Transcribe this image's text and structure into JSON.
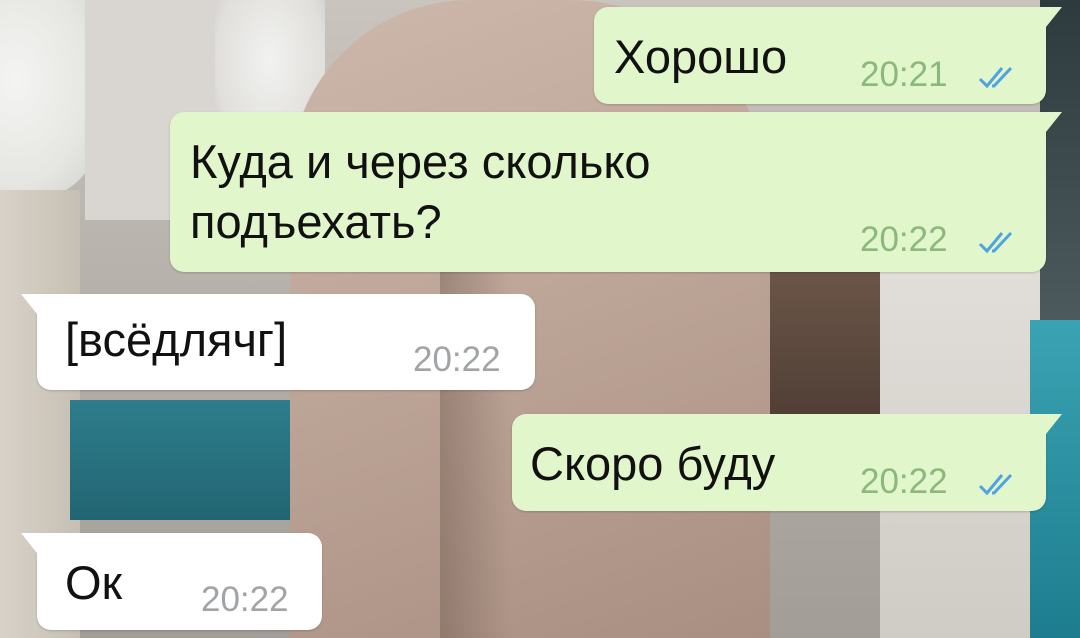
{
  "colors": {
    "outgoing_bubble": "#e1f6ca",
    "incoming_bubble": "#ffffff",
    "outgoing_time": "#8cb87c",
    "incoming_time": "#a0a4a6",
    "read_check": "#4fa3e0"
  },
  "messages": [
    {
      "direction": "outgoing",
      "text": "Хорошо",
      "time": "20:21",
      "status_icon": "double-check-read-icon"
    },
    {
      "direction": "outgoing",
      "text_lines": [
        "Куда и через сколько",
        "подъехать?"
      ],
      "time": "20:22",
      "status_icon": "double-check-read-icon"
    },
    {
      "direction": "incoming",
      "text": "[всёдлячг]",
      "time": "20:22"
    },
    {
      "direction": "outgoing",
      "text": "Скоро буду",
      "time": "20:22",
      "status_icon": "double-check-read-icon"
    },
    {
      "direction": "incoming",
      "text": "Ок",
      "time": "20:22"
    }
  ]
}
